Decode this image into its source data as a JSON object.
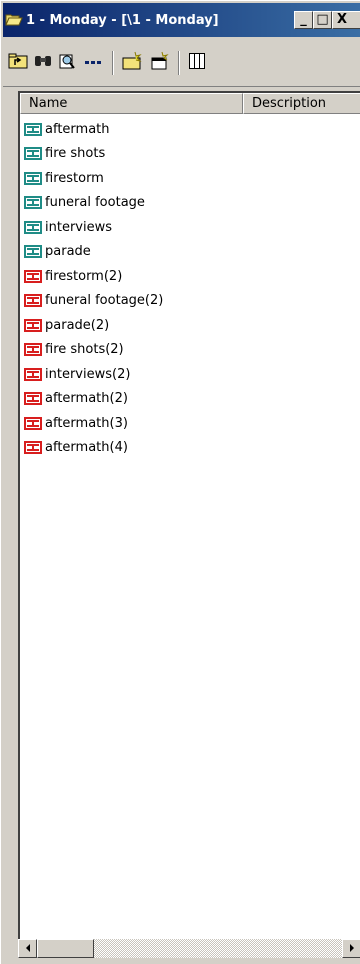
{
  "window": {
    "title": "1 - Monday - [\\1 - Monday]",
    "minimize_glyph": "_",
    "restore_glyph": "□",
    "close_glyph": "X"
  },
  "toolbar": {
    "buttons": [
      {
        "icon": "up-folder-icon"
      },
      {
        "icon": "binoculars-icon"
      },
      {
        "icon": "find-clip-icon"
      },
      {
        "icon": "dotted-more-icon"
      },
      {
        "icon": "new-folder-icon"
      },
      {
        "icon": "new-clip-icon"
      },
      {
        "icon": "columns-view-icon"
      }
    ]
  },
  "table": {
    "columns": [
      "Name",
      "Description"
    ],
    "rows": [
      {
        "name": "aftermath",
        "color": "teal"
      },
      {
        "name": "fire shots",
        "color": "teal"
      },
      {
        "name": "firestorm",
        "color": "teal"
      },
      {
        "name": "funeral footage",
        "color": "teal"
      },
      {
        "name": "interviews",
        "color": "teal"
      },
      {
        "name": "parade",
        "color": "teal"
      },
      {
        "name": "firestorm(2)",
        "color": "red"
      },
      {
        "name": "funeral footage(2)",
        "color": "red"
      },
      {
        "name": "parade(2)",
        "color": "red"
      },
      {
        "name": "fire shots(2)",
        "color": "red"
      },
      {
        "name": "interviews(2)",
        "color": "red"
      },
      {
        "name": "aftermath(2)",
        "color": "red"
      },
      {
        "name": "aftermath(3)",
        "color": "red"
      },
      {
        "name": "aftermath(4)",
        "color": "red"
      }
    ]
  },
  "colors": {
    "titlebar_start": "#0a246a",
    "titlebar_end": "#3a6ea5",
    "clip_teal": "#1f8c86",
    "clip_red": "#d81e1e",
    "face": "#d4d0c8"
  }
}
